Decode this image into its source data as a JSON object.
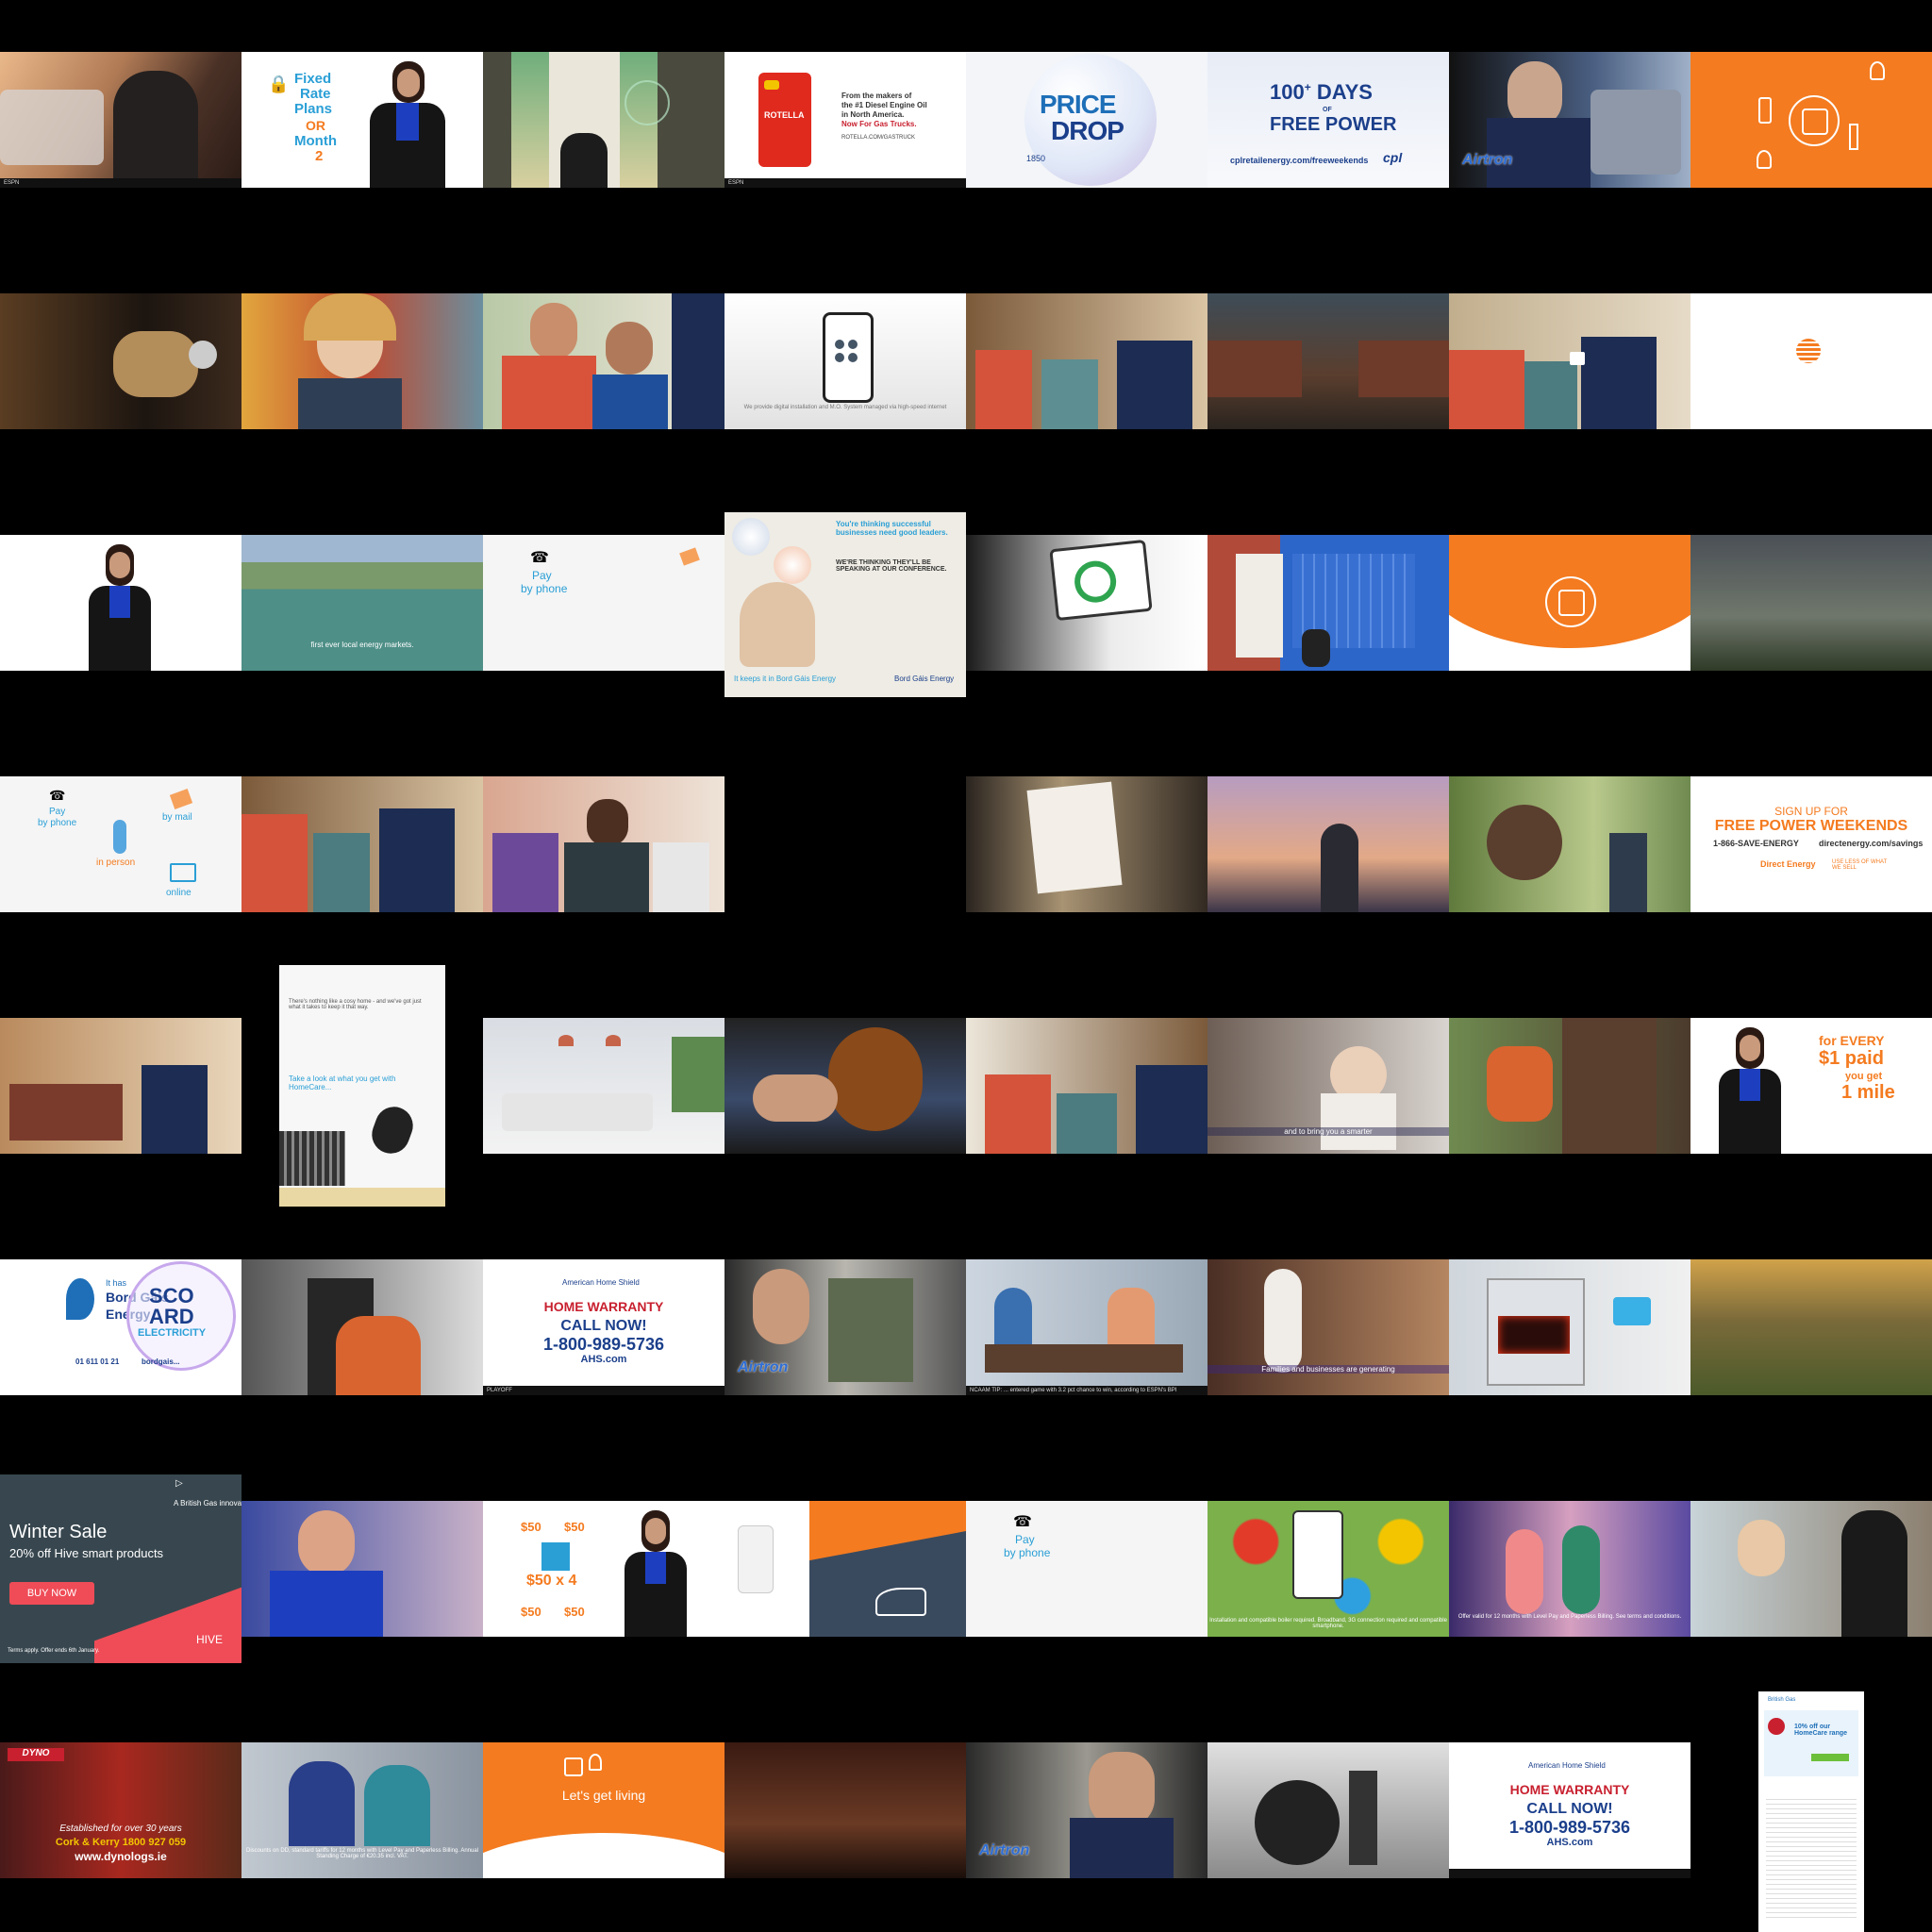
{
  "r1": {
    "c2": {
      "l1": "Fixed",
      "l2": "Rate",
      "l3": "Plans",
      "l4": "OR",
      "l5": "Month",
      "l6": "2"
    },
    "c4": {
      "brand": "Shell",
      "product": "ROTELLA",
      "line1": "From the makers of",
      "line2": "the #1 Diesel Engine Oil",
      "line3": "in North America.",
      "line4": "Now For Gas Trucks.",
      "url": "ROTELLA.COM/GASTRUCK"
    },
    "c5": {
      "l1": "PRICE",
      "l2": "DROP",
      "small": "1850"
    },
    "c6": {
      "l1": "100",
      "sup": "+",
      "l2": "DAYS",
      "of": "OF",
      "l3": "FREE POWER",
      "url": "cplretailenergy.com/freeweekends",
      "brand": "cpl"
    },
    "c7": {
      "brand": "Airtron"
    }
  },
  "r2": {
    "c12": {
      "caption": "We provide digital installation and M.O. System managed via high-speed internet"
    }
  },
  "r3": {
    "c18": {
      "caption": "first ever local energy markets."
    },
    "c19": {
      "l1": "Pay",
      "l2": "by phone"
    },
    "c20": {
      "headline": "You're thinking successful businesses need good leaders.",
      "sub": "WE'RE THINKING THEY'LL BE SPEAKING AT OUR CONFERENCE.",
      "foot": "It keeps it in Bord Gáis Energy",
      "brand": "Bord Gáis Energy"
    }
  },
  "r4": {
    "c25": {
      "a": "Pay",
      "b": "by phone",
      "c": "by mail",
      "d": "in person",
      "e": "online"
    },
    "c32": {
      "l1": "SIGN UP FOR",
      "l2": "FREE POWER WEEKENDS",
      "l3": "1-866-SAVE-ENERGY",
      "l4": "directenergy.com/savings",
      "brand": "Direct Energy",
      "tag": "USE LESS OF WHAT WE SELL"
    }
  },
  "r5": {
    "c34": {
      "p1": "There's nothing like a cosy home - and we've got just what it takes to keep it that way.",
      "p2": "Take a look at what you get with HomeCare..."
    },
    "c38": {
      "caption": "and to bring you a smarter"
    },
    "c40": {
      "l1": "for EVERY",
      "l2": "$1 paid",
      "l3": "you get",
      "l4": "1 mile"
    }
  },
  "r6": {
    "c41": {
      "l1": "It has",
      "l2": "Bord Gáis",
      "l3": "Energy",
      "l4": "SCO",
      "l5": "ARD",
      "l6": "ELECTRICITY",
      "phone": "01 611 01 21",
      "site": "bordgais..."
    },
    "c43": {
      "brand": "American Home Shield",
      "l1": "HOME WARRANTY",
      "l2": "CALL NOW!",
      "l3": "1-800-989-5736",
      "l4": "AHS.com",
      "ticker": "PLAYOFF"
    },
    "c44": {
      "brand": "Airtron"
    },
    "c45": {
      "ticker": "NCAAM TIP: ... entered game with 3.2 pct chance to win, according to ESPN's BPI"
    },
    "c46": {
      "caption": "Families and businesses are generating"
    }
  },
  "r7": {
    "c49": {
      "title": "Winter Sale",
      "sub": "20% off Hive smart products",
      "button": "BUY NOW",
      "brand": "A British Gas innovation",
      "logo": "HIVE",
      "terms": "Terms apply. Offer ends 6th January."
    },
    "c51": {
      "a": "$50",
      "b": "$50",
      "c": "$50 x 4",
      "d": "$50",
      "e": "$50"
    },
    "c53": {
      "l1": "Pay",
      "l2": "by phone"
    },
    "c54": {
      "caption": "Installation and compatible boiler required. Broadband, 3G connection required and compatible smartphone."
    },
    "c55": {
      "caption": "Offer valid for 12 months with Level Pay and Paperless Billing. See terms and conditions."
    }
  },
  "r8": {
    "c57": {
      "brand": "DYNO",
      "l1": "Established for over 30 years",
      "l2": "Cork & Kerry 1800 927 059",
      "l3": "www.dynologs.ie"
    },
    "c58": {
      "caption": "Discounts on DD, standard tariffs for 12 months with Level Pay and Paperless Billing. Annual Standing Charge of €20.35 incl. VAT."
    },
    "c59": {
      "tag": "Let's get living"
    },
    "c61": {
      "brand": "Airtron"
    },
    "c63": {
      "brand": "American Home Shield",
      "l1": "HOME WARRANTY",
      "l2": "CALL NOW!",
      "l3": "1-800-989-5736",
      "l4": "AHS.com"
    },
    "c64": {
      "brand": "British Gas",
      "l1": "10% off our HomeCare range"
    }
  },
  "colors": {
    "orange": "#f47b20",
    "blue": "#1e6fb8",
    "navy": "#1b3f8b",
    "red": "#c8202f"
  }
}
